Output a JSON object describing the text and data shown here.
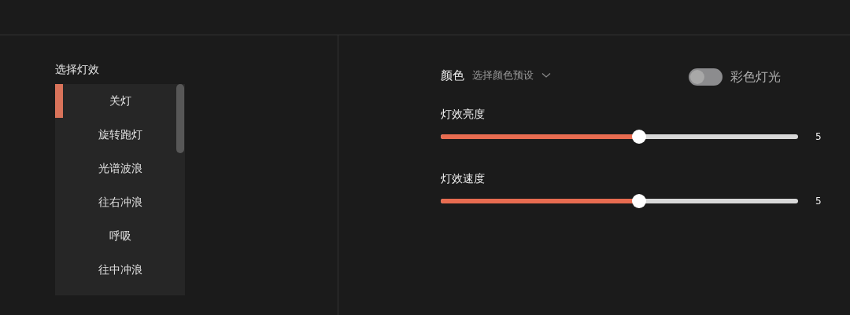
{
  "effects": {
    "label": "选择灯效",
    "items": [
      {
        "label": "关灯",
        "selected": true
      },
      {
        "label": "旋转跑灯",
        "selected": false
      },
      {
        "label": "光谱波浪",
        "selected": false
      },
      {
        "label": "往右冲浪",
        "selected": false
      },
      {
        "label": "呼吸",
        "selected": false
      },
      {
        "label": "往中冲浪",
        "selected": false
      }
    ]
  },
  "color": {
    "label": "颜色",
    "preset": "选择颜色预设"
  },
  "rainbow": {
    "label": "彩色灯光",
    "on": false
  },
  "sliders": [
    {
      "label": "灯效亮度",
      "level": 0.555,
      "reading": "5"
    },
    {
      "label": "灯效速度",
      "level": 0.555,
      "reading": "5"
    }
  ]
}
